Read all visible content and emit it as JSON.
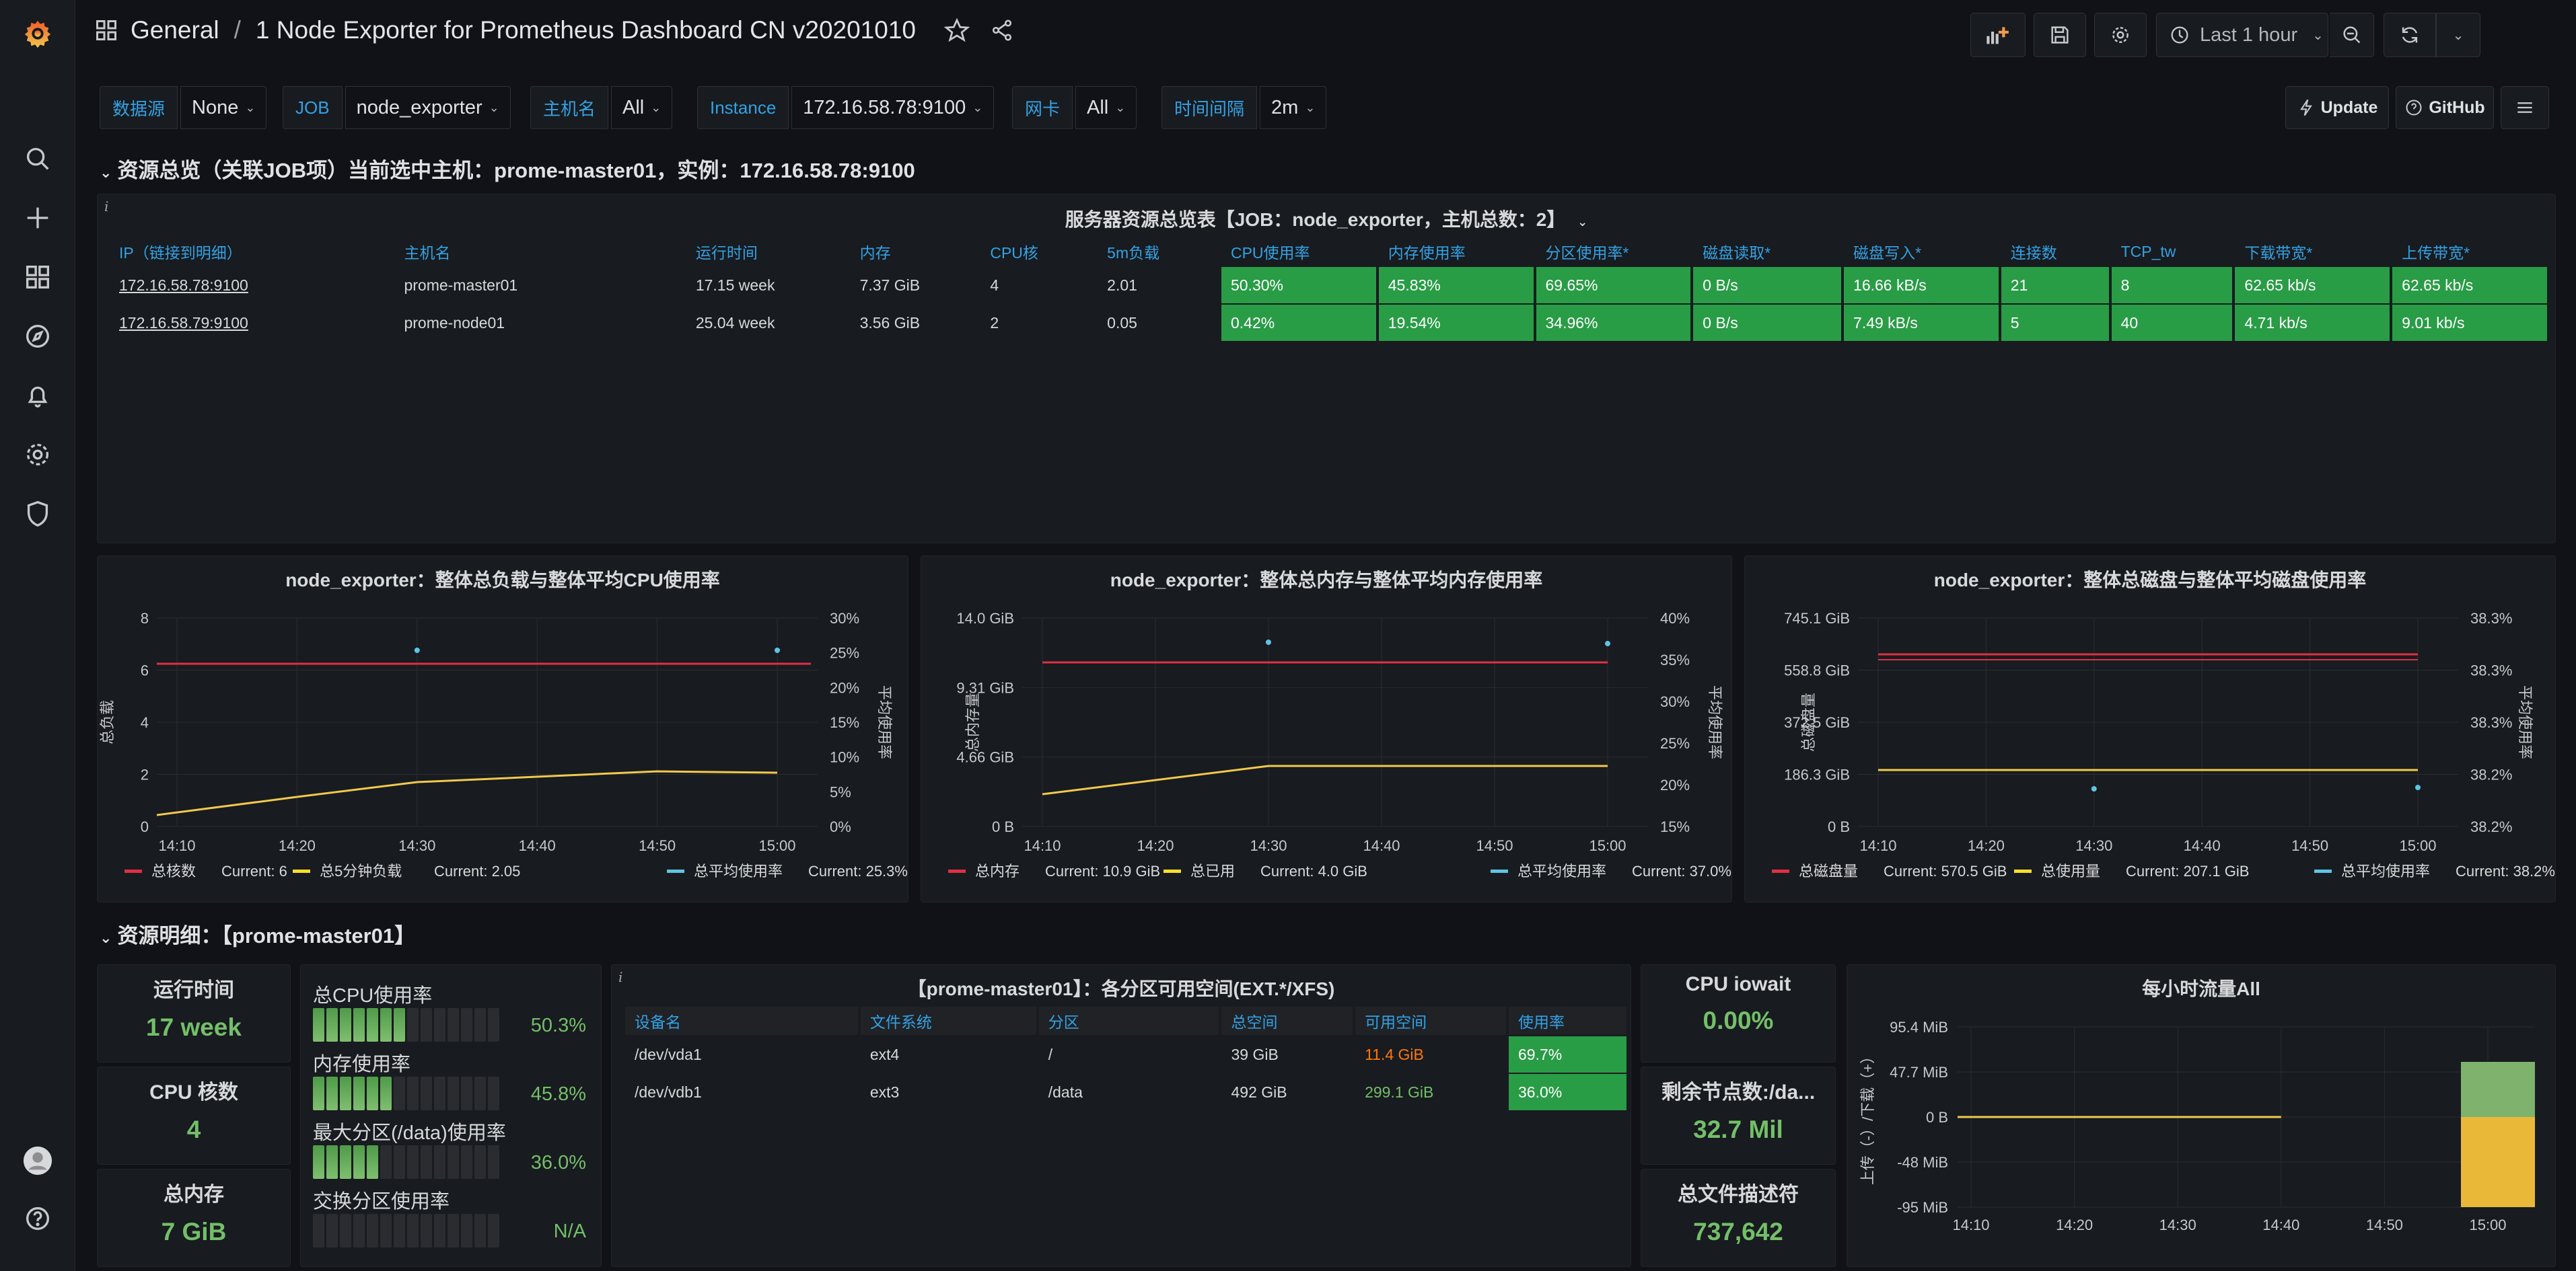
{
  "breadcrumb": {
    "folder": "General",
    "title": "1 Node Exporter for Prometheus Dashboard CN v20201010"
  },
  "toolbar": {
    "time_range": "Last 1 hour"
  },
  "variables": [
    {
      "label": "数据源",
      "value": "None"
    },
    {
      "label": "JOB",
      "value": "node_exporter"
    },
    {
      "label": "主机名",
      "value": "All"
    },
    {
      "label": "Instance",
      "value": "172.16.58.78:9100"
    },
    {
      "label": "网卡",
      "value": "All"
    },
    {
      "label": "时间间隔",
      "value": "2m"
    }
  ],
  "links": {
    "update": "Update",
    "github": "GitHub"
  },
  "row1_title": "资源总览（关联JOB项）当前选中主机：prome-master01，实例：172.16.58.78:9100",
  "overview": {
    "title": "服务器资源总览表【JOB：node_exporter，主机总数：2】",
    "headers": [
      "IP（链接到明细）",
      "主机名",
      "运行时间",
      "内存",
      "CPU核",
      "5m负载",
      "CPU使用率",
      "内存使用率",
      "分区使用率*",
      "磁盘读取*",
      "磁盘写入*",
      "连接数",
      "TCP_tw",
      "下载带宽*",
      "上传带宽*"
    ],
    "rows": [
      [
        "172.16.58.78:9100",
        "prome-master01",
        "17.15 week",
        "7.37 GiB",
        "4",
        "2.01",
        "50.30%",
        "45.83%",
        "69.65%",
        "0 B/s",
        "16.66 kB/s",
        "21",
        "8",
        "62.65 kb/s",
        "62.65 kb/s"
      ],
      [
        "172.16.58.79:9100",
        "prome-node01",
        "25.04 week",
        "3.56 GiB",
        "2",
        "0.05",
        "0.42%",
        "19.54%",
        "34.96%",
        "0 B/s",
        "7.49 kB/s",
        "5",
        "40",
        "4.71 kb/s",
        "9.01 kb/s"
      ]
    ]
  },
  "charts": [
    {
      "title": "node_exporter：整体总负载与整体平均CPU使用率",
      "ylabel_left": "总负载",
      "ylabel_right": "平均使用率",
      "left_ticks": [
        "8",
        "6",
        "4",
        "2",
        "0"
      ],
      "right_ticks": [
        "30%",
        "25%",
        "20%",
        "15%",
        "10%",
        "5%",
        "0%"
      ],
      "x_ticks": [
        "14:10",
        "14:20",
        "14:30",
        "14:40",
        "14:50",
        "15:00"
      ],
      "legend": [
        {
          "name": "总核数",
          "current": "Current: 6",
          "color": "#e02f44"
        },
        {
          "name": "总5分钟负载",
          "current": "Current: 2.05",
          "color": "#fade2a"
        },
        {
          "name": "总平均使用率",
          "current": "Current: 25.3%",
          "color": "#5ec4e3"
        }
      ]
    },
    {
      "title": "node_exporter：整体总内存与整体平均内存使用率",
      "ylabel_left": "总内存量",
      "ylabel_right": "平均使用率",
      "left_ticks": [
        "14.0 GiB",
        "9.31 GiB",
        "4.66 GiB",
        "0 B"
      ],
      "right_ticks": [
        "40%",
        "35%",
        "30%",
        "25%",
        "20%",
        "15%"
      ],
      "x_ticks": [
        "14:10",
        "14:20",
        "14:30",
        "14:40",
        "14:50",
        "15:00"
      ],
      "legend": [
        {
          "name": "总内存",
          "current": "Current: 10.9 GiB",
          "color": "#e02f44"
        },
        {
          "name": "总已用",
          "current": "Current: 4.0 GiB",
          "color": "#fade2a"
        },
        {
          "name": "总平均使用率",
          "current": "Current: 37.0%",
          "color": "#5ec4e3"
        }
      ]
    },
    {
      "title": "node_exporter：整体总磁盘与整体平均磁盘使用率",
      "ylabel_left": "总磁盘量",
      "ylabel_right": "平均使用率",
      "left_ticks": [
        "745.1 GiB",
        "558.8 GiB",
        "372.5 GiB",
        "186.3 GiB",
        "0 B"
      ],
      "right_ticks": [
        "38.3%",
        "38.3%",
        "38.3%",
        "38.2%",
        "38.2%"
      ],
      "x_ticks": [
        "14:10",
        "14:20",
        "14:30",
        "14:40",
        "14:50",
        "15:00"
      ],
      "legend": [
        {
          "name": "总磁盘量",
          "current": "Current: 570.5 GiB",
          "color": "#e02f44"
        },
        {
          "name": "总使用量",
          "current": "Current: 207.1 GiB",
          "color": "#fade2a"
        },
        {
          "name": "总平均使用率",
          "current": "Current: 38.2%",
          "color": "#5ec4e3"
        }
      ]
    }
  ],
  "row2_title": "资源明细：【prome-master01】",
  "stats": {
    "uptime": {
      "title": "运行时间",
      "value": "17 week"
    },
    "cores": {
      "title": "CPU 核数",
      "value": "4"
    },
    "memory": {
      "title": "总内存",
      "value": "7 GiB"
    },
    "iowait": {
      "title": "CPU iowait",
      "value": "0.00%"
    },
    "inodes": {
      "title": "剩余节点数:/da...",
      "value": "32.7 Mil"
    },
    "fd": {
      "title": "总文件描述符",
      "value": "737,642"
    }
  },
  "gauges": [
    {
      "label": "总CPU使用率",
      "value": "50.3%",
      "fraction": 0.503
    },
    {
      "label": "内存使用率",
      "value": "45.8%",
      "fraction": 0.458
    },
    {
      "label": "最大分区(/data)使用率",
      "value": "36.0%",
      "fraction": 0.36
    },
    {
      "label": "交换分区使用率",
      "value": "N/A",
      "fraction": 0
    }
  ],
  "partitions": {
    "title": "【prome-master01】：各分区可用空间(EXT.*/XFS)",
    "headers": [
      "设备名",
      "文件系统",
      "分区",
      "总空间",
      "可用空间",
      "使用率"
    ],
    "rows": [
      [
        "/dev/vda1",
        "ext4",
        "/",
        "39 GiB",
        "11.4 GiB",
        "69.7%"
      ],
      [
        "/dev/vdb1",
        "ext3",
        "/data",
        "492 GiB",
        "299.1 GiB",
        "36.0%"
      ]
    ],
    "avail_colors": [
      "#ff780a",
      "#73bf69"
    ]
  },
  "traffic": {
    "title": "每小时流量All",
    "ylabel": "上传（-）/下载（+）",
    "y_ticks": [
      "95.4 MiB",
      "47.7 MiB",
      "0 B",
      "-48 MiB",
      "-95 MiB"
    ],
    "x_ticks": [
      "14:10",
      "14:20",
      "14:30",
      "14:40",
      "14:50",
      "15:00"
    ]
  }
}
